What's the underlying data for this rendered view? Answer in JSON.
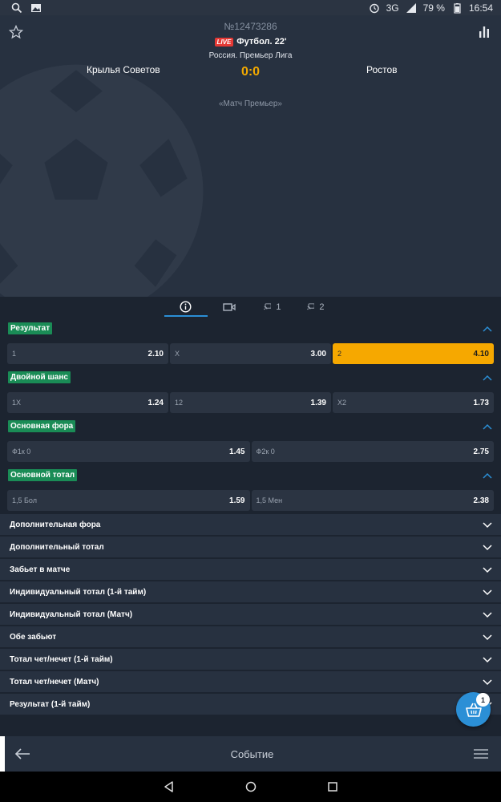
{
  "status_bar": {
    "network": "3G",
    "battery": "79 %",
    "time": "16:54"
  },
  "header": {
    "match_id": "№12473286",
    "live_badge": "LIVE",
    "sport_time": "Футбол. 22'",
    "league": "Россия. Премьер Лига",
    "team_home": "Крылья Советов",
    "team_away": "Ростов",
    "score": "0:0",
    "subtitle": "«Матч Премьер»"
  },
  "tabs": [
    {
      "icon": "info-icon",
      "label": ""
    },
    {
      "icon": "video-icon",
      "label": ""
    },
    {
      "icon": "stream-icon",
      "label": "1"
    },
    {
      "icon": "stream-icon",
      "label": "2"
    }
  ],
  "markets": [
    {
      "title": "Результат",
      "odds": [
        {
          "label": "1",
          "value": "2.10",
          "selected": false
        },
        {
          "label": "X",
          "value": "3.00",
          "selected": false
        },
        {
          "label": "2",
          "value": "4.10",
          "selected": true
        }
      ]
    },
    {
      "title": "Двойной шанс",
      "odds": [
        {
          "label": "1X",
          "value": "1.24",
          "selected": false
        },
        {
          "label": "12",
          "value": "1.39",
          "selected": false
        },
        {
          "label": "X2",
          "value": "1.73",
          "selected": false
        }
      ]
    },
    {
      "title": "Основная фора",
      "odds": [
        {
          "label": "Ф1к 0",
          "value": "1.45",
          "selected": false
        },
        {
          "label": "Ф2к 0",
          "value": "2.75",
          "selected": false
        }
      ]
    },
    {
      "title": "Основной тотал",
      "odds": [
        {
          "label": "1,5 Бол",
          "value": "1.59",
          "selected": false
        },
        {
          "label": "1,5 Мен",
          "value": "2.38",
          "selected": false
        }
      ]
    }
  ],
  "collapsed_markets": [
    "Дополнительная фора",
    "Дополнительный тотал",
    "Забьет в матче",
    "Индивидуальный тотал (1-й тайм)",
    "Индивидуальный тотал (Матч)",
    "Обе забьют",
    "Тотал чет/нечет (1-й тайм)",
    "Тотал чет/нечет (Матч)",
    "Результат (1-й тайм)"
  ],
  "bottom_bar": {
    "title": "Событие"
  },
  "cart": {
    "count": "1"
  },
  "colors": {
    "accent": "#2b8fd6",
    "selected_odd": "#f6a800",
    "market_label": "#1a8c56",
    "score": "#f2a900",
    "live": "#e53935"
  }
}
